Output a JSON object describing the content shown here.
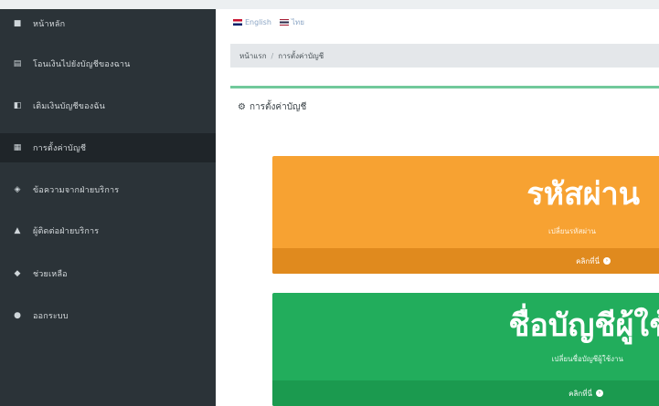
{
  "language": {
    "english_label": "English",
    "thai_label": "ไทย"
  },
  "sidebar": {
    "items": [
      {
        "label": "หน้าหลัก",
        "icon": "home-icon"
      },
      {
        "label": "โอนเงินไปยังบัญชีของฉาน",
        "icon": "transfer-icon"
      },
      {
        "label": "เติมเงินบัญชีของฉัน",
        "icon": "wallet-icon"
      },
      {
        "label": "การตั้งค่าบัญชี",
        "icon": "settings-icon"
      },
      {
        "label": "ข้อความจากฝ่ายบริการ",
        "icon": "message-icon"
      },
      {
        "label": "ผู้ติดต่อฝ่ายบริการ",
        "icon": "user-icon"
      },
      {
        "label": "ช่วยเหลือ",
        "icon": "help-icon"
      },
      {
        "label": "ออกระบบ",
        "icon": "logout-icon"
      }
    ],
    "active_index": 3
  },
  "breadcrumb": {
    "home": "หน้าแรก",
    "current": "การตั้งค่าบัญชี"
  },
  "page": {
    "title": "การตั้งค่าบัญชี"
  },
  "cards": [
    {
      "title": "รหัสผ่าน",
      "subtitle": "เปลี่ยนรหัสผ่าน",
      "footer": "คลิกที่นี่",
      "color": "#f7a232"
    },
    {
      "title": "ชื่อบัญชีผู้ใช้งาน",
      "subtitle": "เปลี่ยนชื่อบัญชีผู้ใช้งาน",
      "footer": "คลิกที่นี่",
      "color": "#22ad5c"
    }
  ]
}
